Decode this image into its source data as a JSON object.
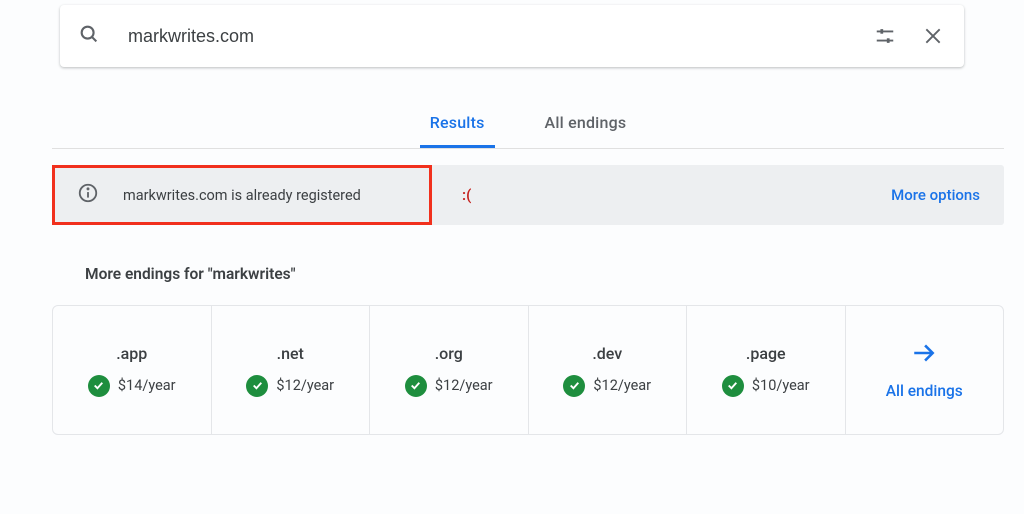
{
  "search": {
    "value": "markwrites.com"
  },
  "tabs": {
    "results": "Results",
    "all_endings": "All endings"
  },
  "status": {
    "message": "markwrites.com is already registered",
    "sad": ":(",
    "more": "More options"
  },
  "subtitle": "More endings for \"markwrites\"",
  "endings": [
    {
      "name": ".app",
      "price": "$14/year"
    },
    {
      "name": ".net",
      "price": "$12/year"
    },
    {
      "name": ".org",
      "price": "$12/year"
    },
    {
      "name": ".dev",
      "price": "$12/year"
    },
    {
      "name": ".page",
      "price": "$10/year"
    }
  ],
  "all_endings_label": "All endings"
}
